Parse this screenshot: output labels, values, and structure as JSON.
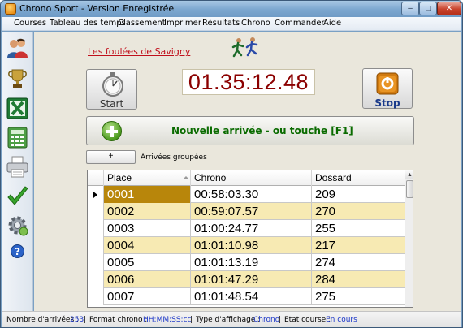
{
  "window": {
    "title": "Chrono Sport - Version Enregistrée",
    "minimize": "–",
    "maximize": "□",
    "close": "✕"
  },
  "menu": [
    {
      "label": "Courses"
    },
    {
      "label": "Tableau des temps"
    },
    {
      "label": "Classement"
    },
    {
      "label": "Imprimer"
    },
    {
      "label": "Résultats"
    },
    {
      "label": "Chrono"
    },
    {
      "label": "Commander"
    },
    {
      "label": "Aide"
    }
  ],
  "sidebar": {
    "icons": [
      {
        "name": "users-icon"
      },
      {
        "name": "trophy-icon"
      },
      {
        "name": "excel-icon"
      },
      {
        "name": "calculator-icon"
      },
      {
        "name": "printer-icon"
      },
      {
        "name": "checkmark-icon"
      },
      {
        "name": "gear-icon"
      },
      {
        "name": "help-icon"
      }
    ]
  },
  "race": {
    "name": "Les foulées de Savigny"
  },
  "timer": {
    "display": "01.35:12.48",
    "start_label": "Start",
    "stop_label": "Stop"
  },
  "arrival": {
    "label": "Nouvelle arrivée  -   ou touche [F1]",
    "group_button": "+",
    "group_label": "Arrivées groupées"
  },
  "table": {
    "headers": [
      "Place",
      "Chrono",
      "Dossard"
    ],
    "rows": [
      {
        "place": "0001",
        "chrono": "00:58:03.30",
        "dossard": "209"
      },
      {
        "place": "0002",
        "chrono": "00:59:07.57",
        "dossard": "270"
      },
      {
        "place": "0003",
        "chrono": "01:00:24.77",
        "dossard": "255"
      },
      {
        "place": "0004",
        "chrono": "01:01:10.98",
        "dossard": "217"
      },
      {
        "place": "0005",
        "chrono": "01:01:13.19",
        "dossard": "274"
      },
      {
        "place": "0006",
        "chrono": "01:01:47.29",
        "dossard": "284"
      },
      {
        "place": "0007",
        "chrono": "01:01:48.54",
        "dossard": "275"
      }
    ],
    "selected_row": 0
  },
  "status": {
    "arrivals_label": "Nombre d'arrivées :",
    "arrivals_value": "253",
    "format_label": "Format chrono :",
    "format_value": "HH:MM:SS:cc",
    "display_label": "Type d'affichage :",
    "display_value": "Chrono",
    "state_label": "Etat course :",
    "state_value": "En cours"
  },
  "colors": {
    "timer_text": "#8b0000",
    "arrival_text": "#0a6b00",
    "stop_text": "#1a3a8a",
    "link_red": "#c0101c",
    "row_alt": "#f7eab3",
    "row_selected": "#b8860b",
    "status_value": "#1a35c8"
  }
}
